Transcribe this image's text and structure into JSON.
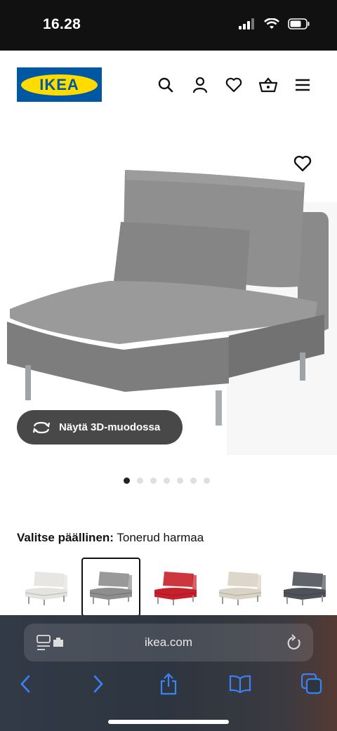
{
  "status": {
    "time": "16.28"
  },
  "header": {
    "logo_text": "IKEA",
    "icons": [
      "search-icon",
      "user-icon",
      "heart-icon",
      "basket-icon",
      "menu-icon"
    ]
  },
  "product": {
    "view_3d_label": "Näytä 3D-muodossa",
    "image_count": 7,
    "active_image": 1
  },
  "cover": {
    "label": "Valitse päällinen:",
    "value": "Tonerud harmaa",
    "swatches": [
      {
        "color": "#e4e3df",
        "selected": false
      },
      {
        "color": "#8e8e8e",
        "selected": true
      },
      {
        "color": "#c8202a",
        "selected": false
      },
      {
        "color": "#d9d3c5",
        "selected": false
      },
      {
        "color": "#50525a",
        "selected": false
      }
    ]
  },
  "browser": {
    "url": "ikea.com"
  }
}
